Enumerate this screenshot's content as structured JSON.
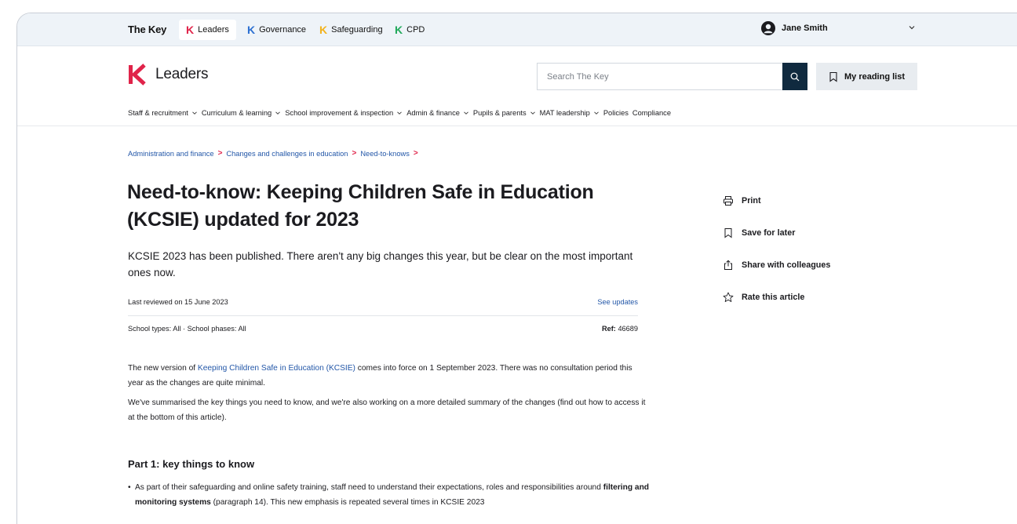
{
  "topbar": {
    "brand": "The Key",
    "products": [
      {
        "k": "K",
        "label": "Leaders",
        "color": "#e0244a"
      },
      {
        "k": "K",
        "label": "Governance",
        "color": "#2b6fd1"
      },
      {
        "k": "K",
        "label": "Safeguarding",
        "color": "#f2b21b"
      },
      {
        "k": "K",
        "label": "CPD",
        "color": "#22a95b"
      }
    ],
    "user_name": "Jane Smith"
  },
  "header": {
    "logo_text": "Leaders",
    "search_placeholder": "Search The Key",
    "reading_list_label": "My reading list"
  },
  "nav": {
    "items": [
      "Staff & recruitment",
      "Curriculum & learning",
      "School improvement & inspection",
      "Admin & finance",
      "Pupils & parents",
      "MAT leadership",
      "Policies",
      "Compliance"
    ]
  },
  "breadcrumb": [
    "Administration and finance",
    "Changes and challenges in education",
    "Need-to-knows"
  ],
  "article": {
    "title": "Need-to-know: Keeping Children Safe in Education (KCSIE) updated for 2023",
    "standfirst": "KCSIE 2023 has been published. There aren't any big changes this year, but be clear on the most important ones now.",
    "last_reviewed": "Last reviewed on 15 June 2023",
    "see_updates": "See updates",
    "school_types": "School types: All · School phases: All",
    "ref_label": "Ref:",
    "ref_value": "46689",
    "p1_before": "The new version of ",
    "p1_link": "Keeping Children Safe in Education (KCSIE)",
    "p1_after": " comes into force on 1 September 2023. There was no consultation period this year as the changes are quite minimal.",
    "p2": "We've summarised the key things you need to know, and we're also working on a more detailed summary of the changes (find out how to access it at the bottom of this article).",
    "part1_heading": "Part 1: key things to know",
    "bullet_before": "As part of their safeguarding and online safety training, staff need to understand their expectations, roles and responsibilities around ",
    "bullet_bold": "filtering and monitoring systems",
    "bullet_after": " (paragraph 14). This new emphasis is repeated several times in KCSIE 2023"
  },
  "actions": [
    "Print",
    "Save for later",
    "Share with colleagues",
    "Rate this article"
  ],
  "icons": {
    "search": "search-icon",
    "bookmark": "bookmark-icon",
    "print": "print-icon",
    "share": "share-icon",
    "star": "star-icon",
    "user": "user-icon",
    "chevron": "chevron-down-icon"
  },
  "colors": {
    "brand_pink": "#e0244a",
    "link_blue": "#2357a8",
    "search_button": "#102a3f",
    "topbar_bg": "#eef3f8"
  }
}
